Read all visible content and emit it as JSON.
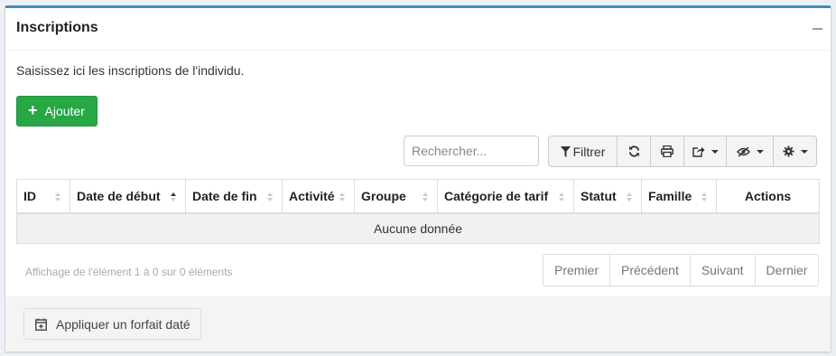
{
  "panel": {
    "title": "Inscriptions",
    "intro": "Saisissez ici les inscriptions de l'individu."
  },
  "actions": {
    "add_label": "Ajouter"
  },
  "search": {
    "placeholder": "Rechercher..."
  },
  "toolbar": {
    "filter_label": "Filtrer",
    "icons": [
      "filter-icon",
      "refresh-icon",
      "print-icon",
      "export-icon",
      "columns-visibility-icon",
      "settings-icon"
    ]
  },
  "table": {
    "columns": [
      "ID",
      "Date de début",
      "Date de fin",
      "Activité",
      "Groupe",
      "Catégorie de tarif",
      "Statut",
      "Famille",
      "Actions"
    ],
    "empty_text": "Aucune donnée",
    "sorted_column": "Date de début"
  },
  "pagination": {
    "info": "Affichage de l'élément 1 à 0 sur 0 éléments",
    "first": "Premier",
    "previous": "Précédent",
    "next": "Suivant",
    "last": "Dernier"
  },
  "footer": {
    "apply_label": "Appliquer un forfait daté"
  },
  "colors": {
    "accent": "#3c8dbc",
    "success": "#28a745"
  }
}
